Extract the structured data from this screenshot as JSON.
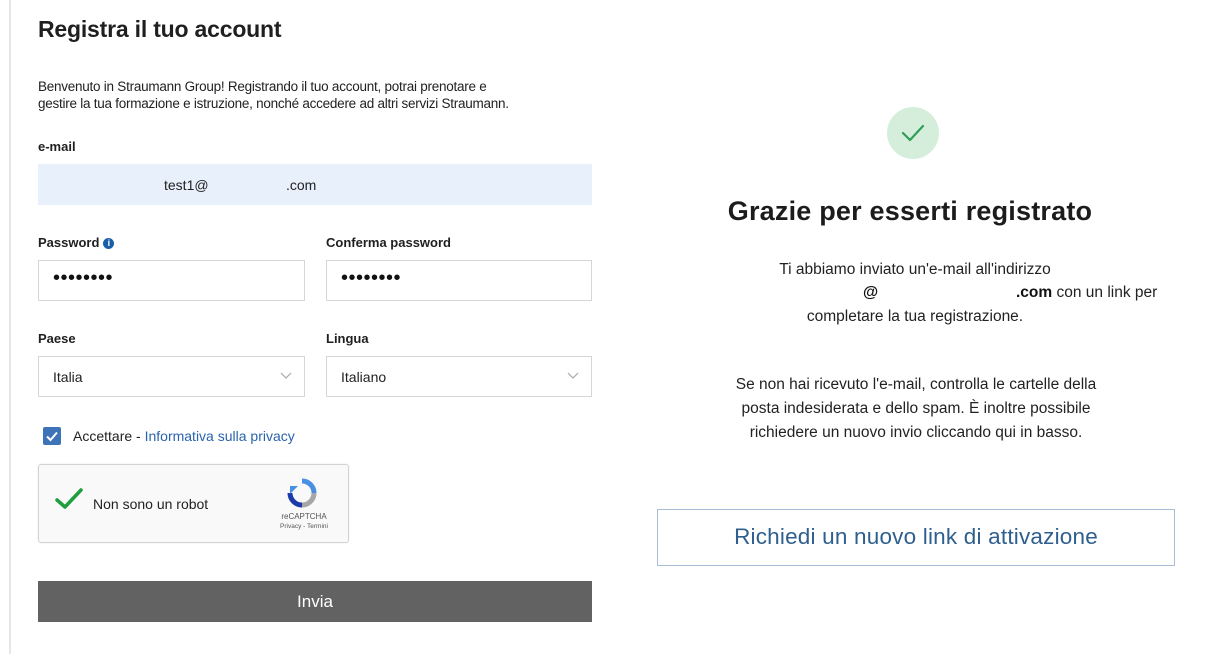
{
  "form": {
    "title": "Registra il tuo account",
    "intro_line1": "Benvenuto in Straumann Group! Registrando il tuo account, potrai prenotare e",
    "intro_line2": "gestire la tua formazione e istruzione, nonché accedere ad altri servizi Straumann.",
    "email": {
      "label": "e-mail",
      "value_local": "test1@",
      "value_tld": ".com"
    },
    "password": {
      "label": "Password",
      "info_icon": "i",
      "value": "••••••••"
    },
    "confirm_password": {
      "label": "Conferma password",
      "value": "••••••••"
    },
    "country": {
      "label": "Paese",
      "selected": "Italia"
    },
    "language": {
      "label": "Lingua",
      "selected": "Italiano"
    },
    "consent": {
      "checked": true,
      "text": "Accettare - ",
      "link": "Informativa sulla privacy"
    },
    "captcha": {
      "label": "Non sono un robot",
      "brand": "reCAPTCHA",
      "terms": "Privacy - Termini"
    },
    "submit_label": "Invia"
  },
  "confirmation": {
    "title": "Grazie per esserti registrato",
    "p1_line1": "Ti abbiamo inviato un'e-mail all'indirizzo",
    "p1_at": "@",
    "p1_domain": ".com",
    "p1_after": " con un link per",
    "p1_line3": "completare la tua registrazione.",
    "p2_line1": "Se non hai ricevuto l'e-mail, controlla le cartelle della",
    "p2_line2": "posta indesiderata e dello spam. È inoltre possibile",
    "p2_line3": "richiedere un nuovo invio cliccando qui in basso.",
    "resend_button": "Richiedi un nuovo link di attivazione"
  },
  "colors": {
    "accent_blue": "#3d73b7",
    "link_blue": "#2a63ad",
    "submit_gray": "#626262",
    "success_green_bg": "#d5eedb",
    "success_green_check": "#2f9e57"
  }
}
